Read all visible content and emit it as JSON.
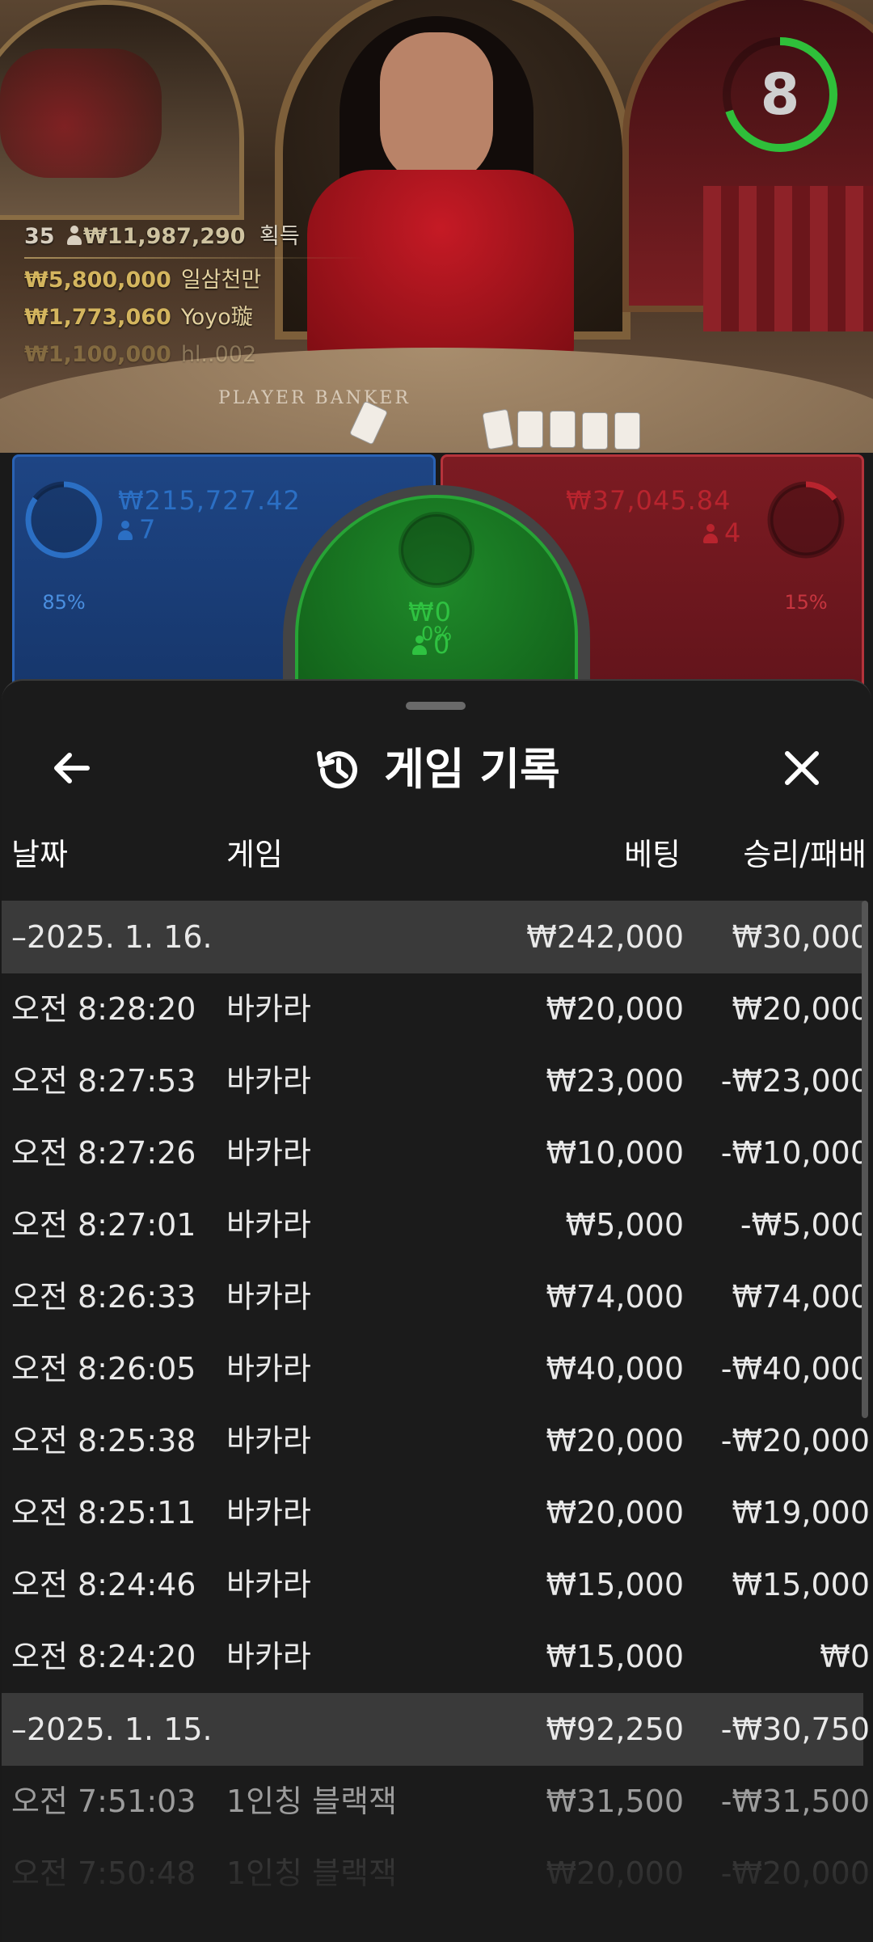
{
  "timer": {
    "value": "8",
    "fraction_remaining": 0.7
  },
  "winners": {
    "total": {
      "count": "35",
      "amount": "₩11,987,290",
      "label": "획득"
    },
    "list": [
      {
        "amount": "₩5,800,000",
        "name": "일삼천만"
      },
      {
        "amount": "₩1,773,060",
        "name": "Yoyo璇"
      },
      {
        "amount": "₩1,100,000",
        "name": "hl..002"
      }
    ]
  },
  "table_text": "PLAYER       BANKER",
  "bets": {
    "player": {
      "percent": "85%",
      "percent_value": 0.85,
      "amount": "₩215,727.42",
      "players": "7",
      "color": "#2b6fc4"
    },
    "tie": {
      "percent": "0%",
      "percent_value": 0.0,
      "amount": "₩0",
      "players": "0",
      "color": "#2fc241"
    },
    "banker": {
      "percent": "15%",
      "percent_value": 0.15,
      "amount": "₩37,045.84",
      "players": "4",
      "color": "#b8242e"
    }
  },
  "history": {
    "title": "게임 기록",
    "columns": {
      "date": "날짜",
      "game": "게임",
      "bet": "베팅",
      "win": "승리/패배"
    },
    "rows": [
      {
        "kind": "day",
        "date": "–2025. 1. 16.",
        "game": "",
        "bet": "₩242,000",
        "win": "₩30,000"
      },
      {
        "kind": "item",
        "date": "오전 8:28:20",
        "game": "바카라",
        "bet": "₩20,000",
        "win": "₩20,000"
      },
      {
        "kind": "item",
        "date": "오전 8:27:53",
        "game": "바카라",
        "bet": "₩23,000",
        "win": "-₩23,000"
      },
      {
        "kind": "item",
        "date": "오전 8:27:26",
        "game": "바카라",
        "bet": "₩10,000",
        "win": "-₩10,000"
      },
      {
        "kind": "item",
        "date": "오전 8:27:01",
        "game": "바카라",
        "bet": "₩5,000",
        "win": "-₩5,000"
      },
      {
        "kind": "item",
        "date": "오전 8:26:33",
        "game": "바카라",
        "bet": "₩74,000",
        "win": "₩74,000"
      },
      {
        "kind": "item",
        "date": "오전 8:26:05",
        "game": "바카라",
        "bet": "₩40,000",
        "win": "-₩40,000"
      },
      {
        "kind": "item",
        "date": "오전 8:25:38",
        "game": "바카라",
        "bet": "₩20,000",
        "win": "-₩20,000"
      },
      {
        "kind": "item",
        "date": "오전 8:25:11",
        "game": "바카라",
        "bet": "₩20,000",
        "win": "₩19,000"
      },
      {
        "kind": "item",
        "date": "오전 8:24:46",
        "game": "바카라",
        "bet": "₩15,000",
        "win": "₩15,000"
      },
      {
        "kind": "item",
        "date": "오전 8:24:20",
        "game": "바카라",
        "bet": "₩15,000",
        "win": "₩0"
      },
      {
        "kind": "day",
        "date": "–2025. 1. 15.",
        "game": "",
        "bet": "₩92,250",
        "win": "-₩30,750"
      },
      {
        "kind": "dim",
        "date": "오전 7:51:03",
        "game": "1인칭 블랙잭",
        "bet": "₩31,500",
        "win": "-₩31,500"
      },
      {
        "kind": "fade",
        "date": "오전 7:50:48",
        "game": "1인칭 블랙잭",
        "bet": "₩20,000",
        "win": "-₩20,000"
      }
    ]
  }
}
